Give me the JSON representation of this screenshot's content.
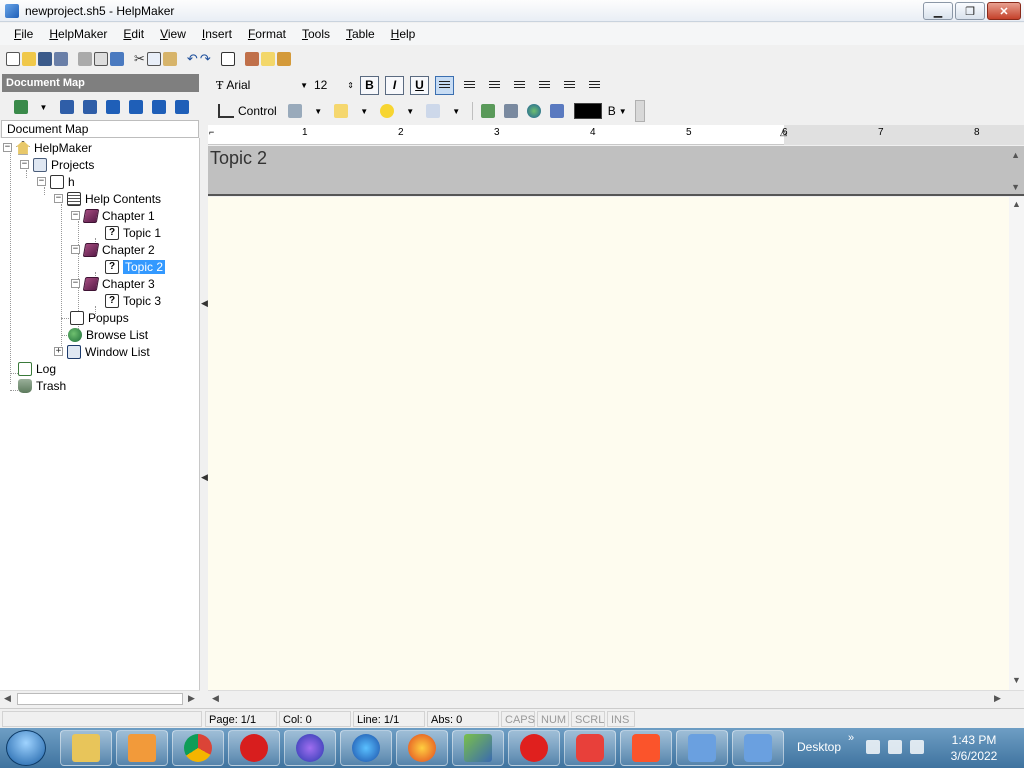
{
  "window": {
    "title": "newproject.sh5 - HelpMaker",
    "minimize": "▁",
    "maximize": "❐",
    "close": "✕"
  },
  "menu": [
    "File",
    "HelpMaker",
    "Edit",
    "View",
    "Insert",
    "Format",
    "Tools",
    "Table",
    "Help"
  ],
  "document_map": {
    "header": "Document Map",
    "label": "Document Map"
  },
  "tree": {
    "root": "HelpMaker",
    "projects": "Projects",
    "project": "h",
    "help_contents": "Help Contents",
    "chapter1": "Chapter 1",
    "topic1": "Topic 1",
    "chapter2": "Chapter 2",
    "topic2": "Topic 2",
    "chapter3": "Chapter 3",
    "topic3": "Topic 3",
    "popups": "Popups",
    "browse_list": "Browse List",
    "window_list": "Window List",
    "log": "Log",
    "trash": "Trash"
  },
  "format": {
    "font": "Arial",
    "size": "12",
    "bold": "B",
    "italic": "I",
    "underline": "U",
    "control_label": "Control",
    "color_label": "B",
    "text_color": "#000000"
  },
  "ruler": [
    "1",
    "2",
    "3",
    "4",
    "5",
    "6",
    "7",
    "8"
  ],
  "editor": {
    "topic_title": "Topic 2",
    "background": "#fefcef"
  },
  "status": {
    "page": "Page: 1/1",
    "col": "Col: 0",
    "line": "Line: 1/1",
    "abs": "Abs: 0",
    "caps": "CAPS",
    "num": "NUM",
    "scrl": "SCRL",
    "ins": "INS"
  },
  "taskbar": {
    "desktop": "Desktop",
    "time": "1:43 PM",
    "date": "3/6/2022",
    "apps": [
      "explorer",
      "media-player",
      "chrome",
      "opera",
      "firefox-nightly",
      "firefox-dev",
      "firefox",
      "app-tool",
      "opera-gx",
      "vivaldi",
      "brave",
      "help",
      "help"
    ]
  }
}
